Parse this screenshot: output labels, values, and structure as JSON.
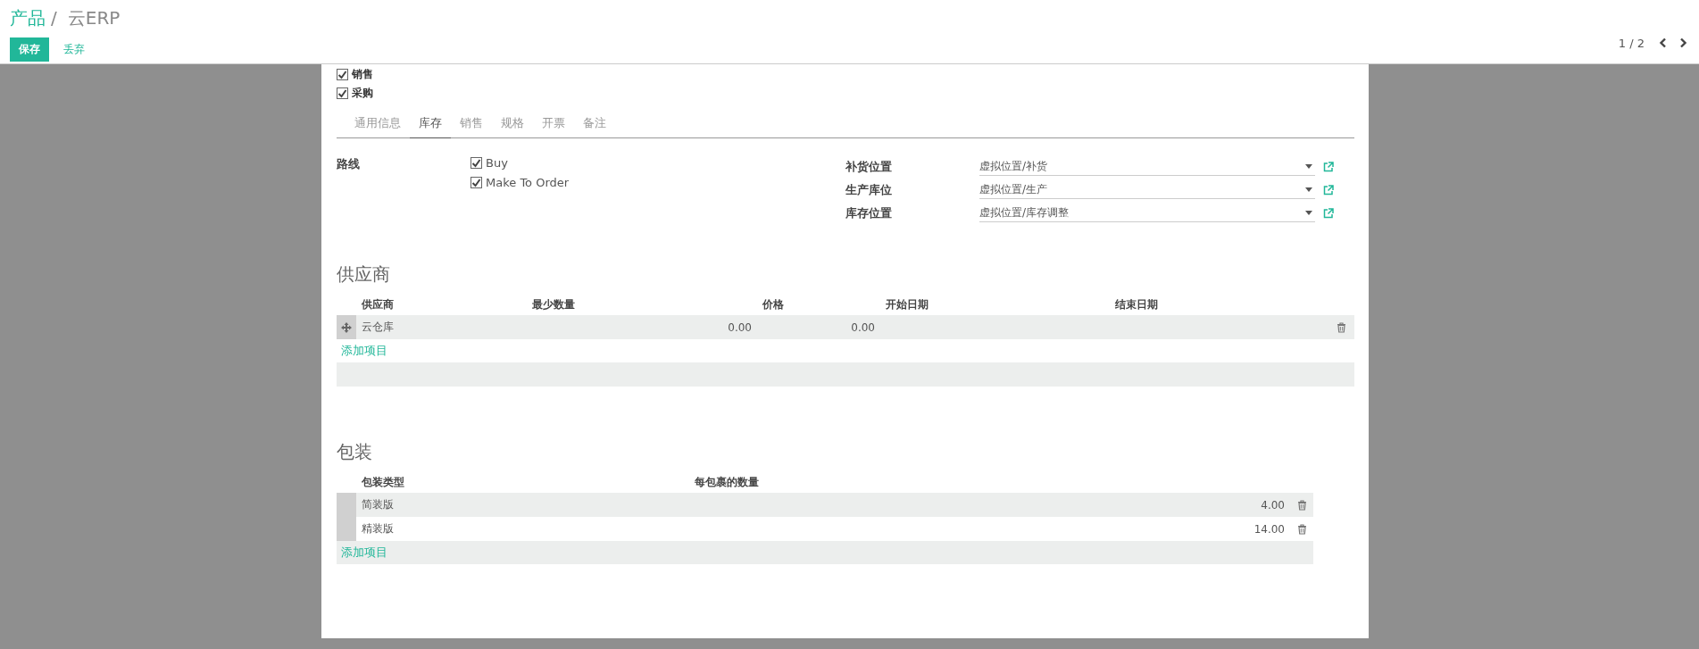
{
  "breadcrumb": [
    {
      "label": "产品",
      "kind": "link"
    },
    {
      "label": "云ERP",
      "kind": "current",
      "separator": "/"
    }
  ],
  "buttons": [
    {
      "label": "保存",
      "kind": "primary"
    },
    {
      "label": "丢弃",
      "kind": "link"
    }
  ],
  "pager": {
    "text": "1 / 2"
  },
  "checkboxes": [
    {
      "label": "销售",
      "checked": true
    },
    {
      "label": "采购",
      "checked": true
    }
  ],
  "tabs": [
    {
      "label": "通用信息",
      "selected": false
    },
    {
      "label": "库存",
      "selected": true
    },
    {
      "label": "销售",
      "selected": false
    },
    {
      "label": "规格",
      "selected": false
    },
    {
      "label": "开票",
      "selected": false
    },
    {
      "label": "备注",
      "selected": false
    }
  ],
  "routes": {
    "label": "路线",
    "options": [
      {
        "label": "Buy",
        "checked": true
      },
      {
        "label": "Make To Order",
        "checked": true
      }
    ]
  },
  "locations": [
    {
      "label": "补货位置",
      "value": "虚拟位置/补货"
    },
    {
      "label": "生产库位",
      "value": "虚拟位置/生产"
    },
    {
      "label": "库存位置",
      "value": "虚拟位置/库存调整"
    }
  ],
  "suppliers": {
    "title": "供应商",
    "columns": [
      "供应商",
      "最少数量",
      "价格",
      "开始日期",
      "结束日期"
    ],
    "rows": [
      {
        "cells": [
          "云仓库",
          "0.00",
          "0.00"
        ]
      }
    ],
    "add_label": "添加项目"
  },
  "packaging": {
    "title": "包装",
    "columns": [
      "包装类型",
      "每包裹的数量"
    ],
    "rows": [
      {
        "cells": [
          "简装版",
          "4.00"
        ]
      },
      {
        "cells": [
          "精装版",
          "14.00"
        ]
      }
    ],
    "add_label": "添加项目"
  }
}
